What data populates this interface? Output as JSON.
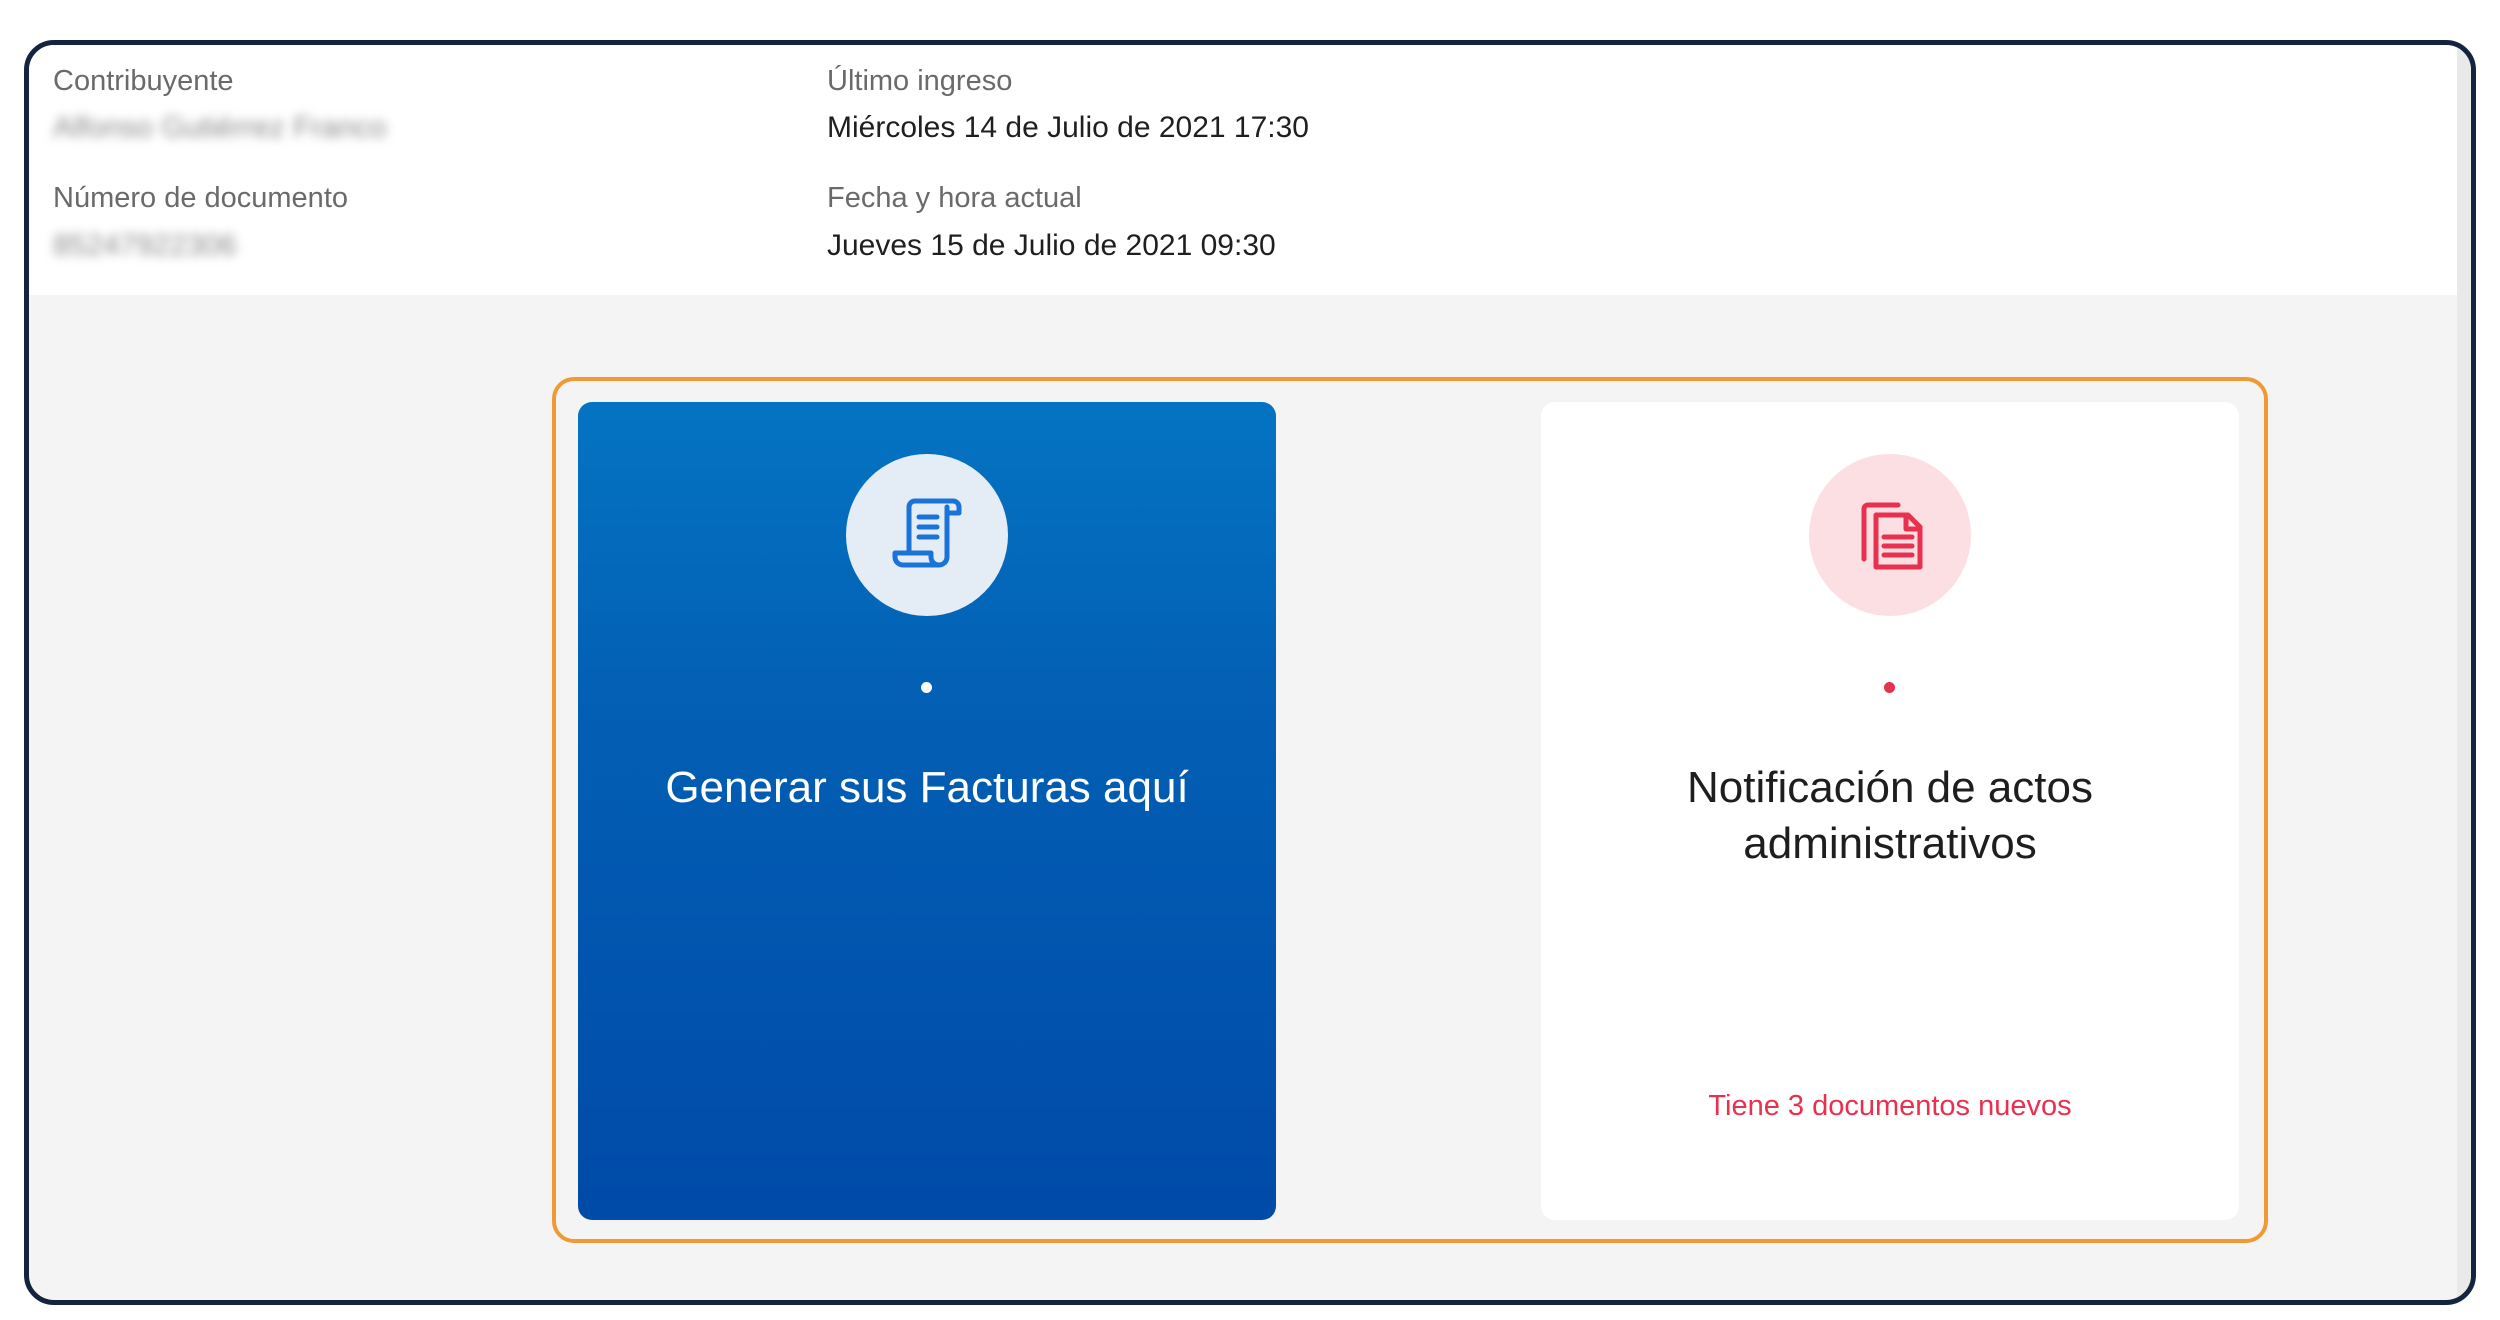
{
  "header": {
    "taxpayer_label": "Contribuyente",
    "taxpayer_value": "Alfonso Gutiérrez Franco",
    "document_label": "Número de documento",
    "document_value": "85247922306",
    "last_login_label": "Último ingreso",
    "last_login_value": "Miércoles 14 de Julio de 2021 17:30",
    "current_time_label": "Fecha y hora actual",
    "current_time_value": "Jueves 15 de Julio de 2021 09:30"
  },
  "cards": [
    {
      "title": "Generar sus Facturas aquí",
      "icon": "receipt-scroll-icon"
    },
    {
      "title": "Notificación de actos administrativos",
      "icon": "documents-icon",
      "note": "Tiene 3 documentos nuevos"
    }
  ],
  "colors": {
    "frame_border": "#14243f",
    "highlight": "#f09a35",
    "card_blue": "#0360b4",
    "accent_red": "#e8304f"
  }
}
